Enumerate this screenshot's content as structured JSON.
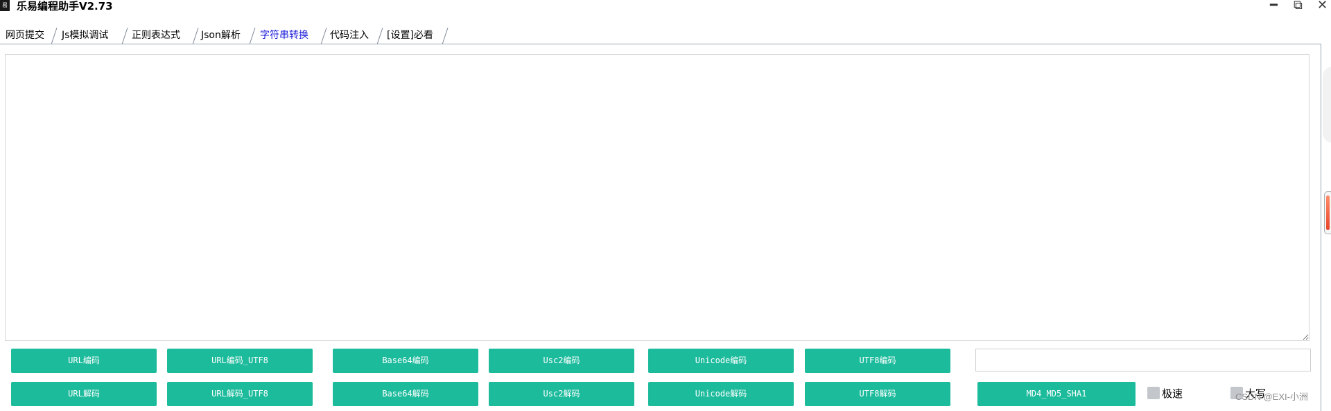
{
  "window": {
    "title": "乐易编程助手V2.73",
    "icon_name": "app-logo-icon",
    "icon_glyph": "易",
    "controls": {
      "minimize": "━",
      "maximize": "⧉",
      "close": "✕"
    }
  },
  "tabs": [
    {
      "label": "网页提交",
      "active": false
    },
    {
      "label": "Js模拟调试",
      "active": false
    },
    {
      "label": "正则表达式",
      "active": false
    },
    {
      "label": "Json解析",
      "active": false
    },
    {
      "label": "字符串转换",
      "active": true
    },
    {
      "label": "代码注入",
      "active": false
    },
    {
      "label": "[设置]必看",
      "active": false
    }
  ],
  "output": {
    "value": ""
  },
  "buttons": {
    "row1": [
      "URL编码",
      "URL编码_UTF8",
      "Base64编码",
      "Usc2编码",
      "Unicode编码",
      "UTF8编码"
    ],
    "row2": [
      "URL解码",
      "URL解码_UTF8",
      "Base64解码",
      "Usc2解码",
      "Unicode解码",
      "UTF8解码"
    ],
    "hash": "MD4_MD5_SHA1"
  },
  "hash_input": {
    "value": ""
  },
  "options": [
    {
      "label": "极速",
      "checked": false
    },
    {
      "label": "大写",
      "checked": false
    }
  ],
  "watermark": "CSDN @EXI-小洲",
  "colors": {
    "button": "#1cbb9c",
    "active_tab": "#1818d8",
    "scroll_thumb": "#e8452a"
  }
}
